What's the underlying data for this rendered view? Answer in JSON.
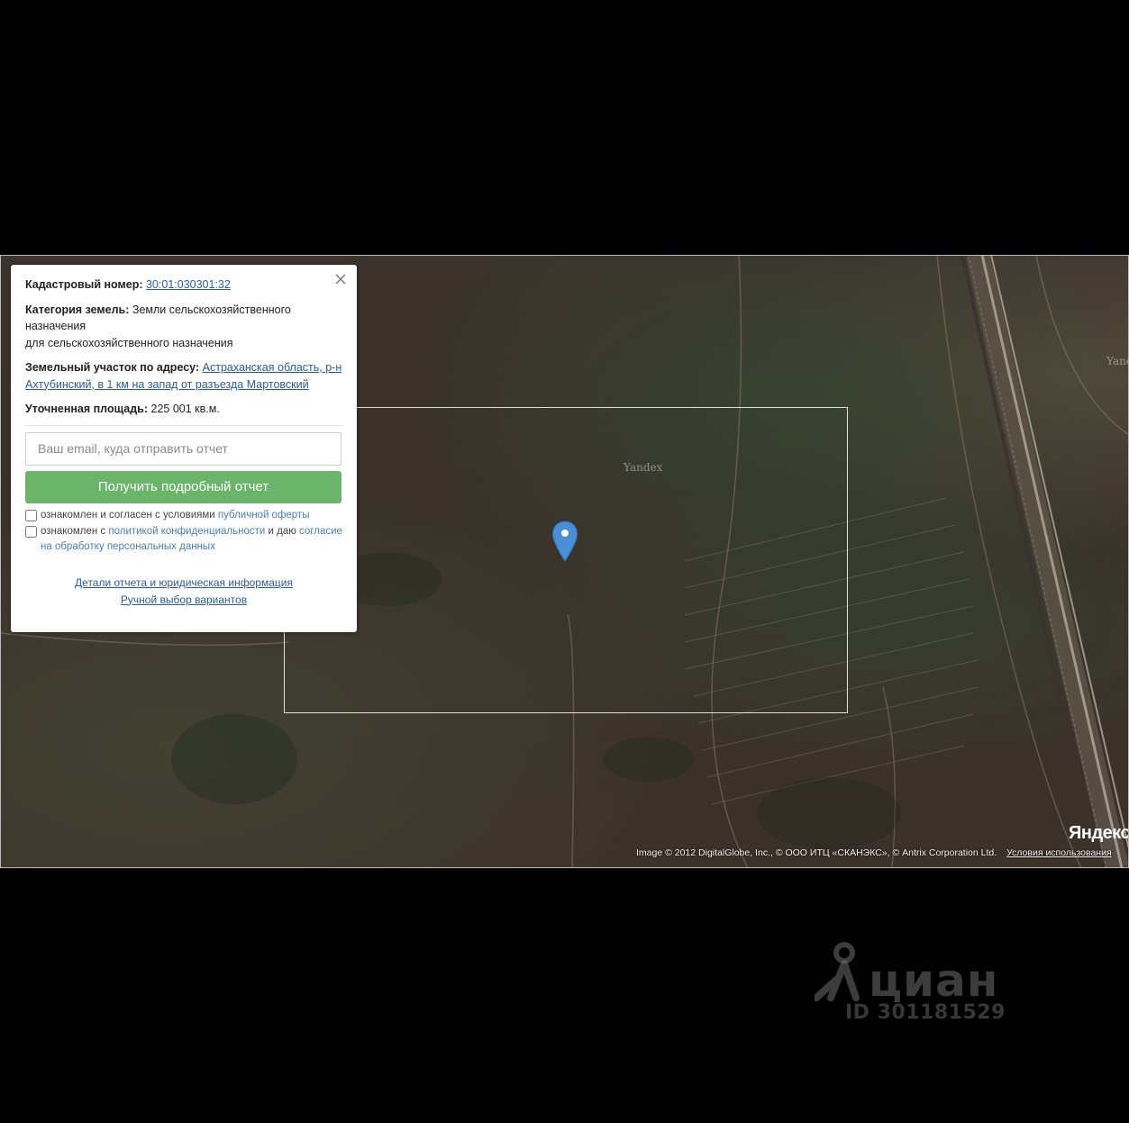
{
  "card": {
    "cadastral_label": "Кадастровый номер:",
    "cadastral_value": "30:01:030301:32",
    "category_label": "Категория земель:",
    "category_value": "Земли сельскохозяйственного назначения",
    "category_use": "для сельскохозяйственного назначения",
    "address_label": "Земельный участок по адресу:",
    "address_value": "Астраханская область, р-н Ахтубинский, в 1 км на запад от разъезда Мартовский",
    "area_label": "Уточненная площадь:",
    "area_value": "225 001 кв.м.",
    "email_placeholder": "Ваш email, куда отправить отчет",
    "report_button": "Получить подробный отчет",
    "consent1_text": "ознакомлен и согласен с условиями",
    "consent1_link": "публичной оферты",
    "consent2_text": "ознакомлен с",
    "consent2_link": "политикой конфиденциальности",
    "consent2_mid": "и даю",
    "consent2_link2": "согласие на обработку персональных данных",
    "details_link": "Детали отчета и юридическая информация",
    "manual_link": "Ручной выбор вариантов"
  },
  "map": {
    "watermark": "Yandex",
    "logo": "Яндекс",
    "attribution": "Image © 2012 DigitalGlobe, Inc., © ООО ИТЦ «СКАНЭКС», © Antrix Corporation Ltd.",
    "terms_link": "Условия использования",
    "pin_color": "#4a8fd6"
  },
  "watermark": {
    "brand": "циан",
    "listing_id": "ID 301181529"
  }
}
